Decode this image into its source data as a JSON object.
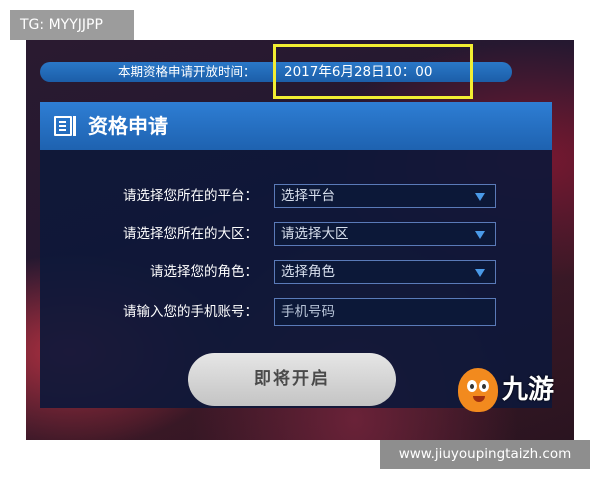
{
  "overlay": {
    "tg_text": "TG: MYYJJPP",
    "watermark_text": "www.jiuyoupingtaizh.com"
  },
  "banner": {
    "label": "本期资格申请开放时间：",
    "time": "2017年6月28日10：00",
    "highlight_color": "#f2ee32"
  },
  "panel": {
    "icon": "document-icon",
    "title": "资格申请",
    "header_color": "#2e7ed4"
  },
  "form": {
    "platform": {
      "label": "请选择您所在的平台：",
      "value": "选择平台"
    },
    "region": {
      "label": "请选择您所在的大区：",
      "value": "请选择大区"
    },
    "role": {
      "label": "请选择您的角色：",
      "value": "选择角色"
    },
    "phone": {
      "label": "请输入您的手机账号：",
      "placeholder": "手机号码"
    }
  },
  "button": {
    "label": "即将开启"
  },
  "logo": {
    "text": "九游",
    "icon": "mascot-icon"
  }
}
